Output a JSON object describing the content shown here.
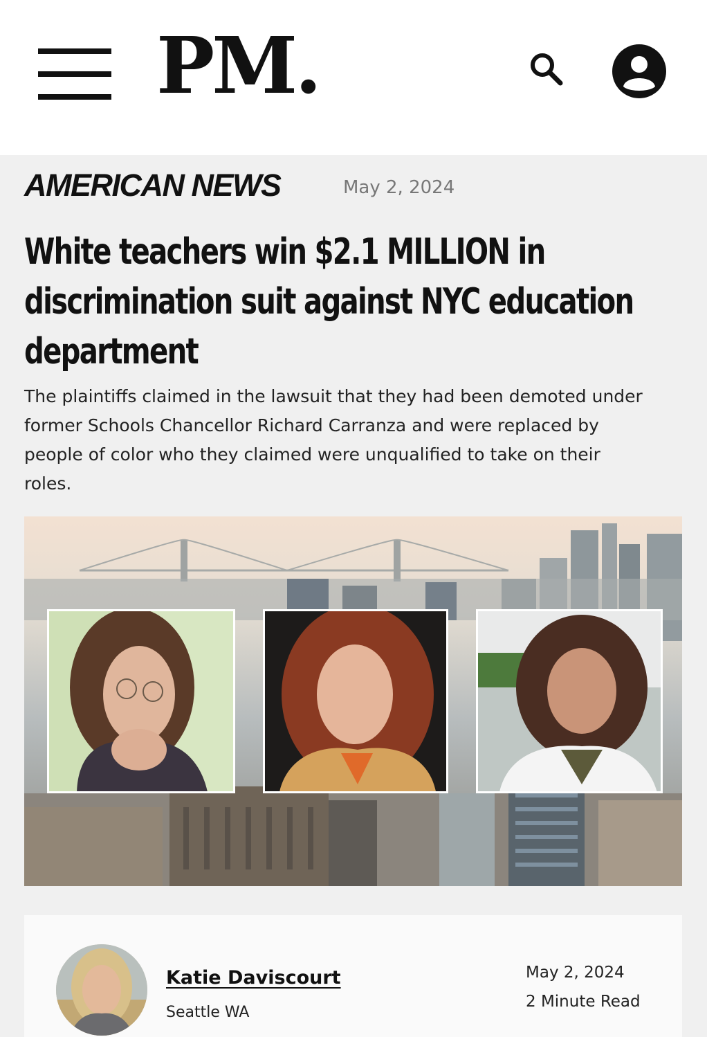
{
  "header": {
    "logo": "PM.",
    "menu_icon": "hamburger-menu-icon",
    "search_icon": "search-icon",
    "account_icon": "user-account-icon"
  },
  "article": {
    "category": "AMERICAN NEWS",
    "date": "May 2, 2024",
    "headline": "White teachers win $2.1 MILLION in discrimination suit against NYC education department",
    "dek": "The plaintiffs claimed in the lawsuit that they had been demoted under former Schools Chancellor Richard Carranza and were replaced by people of color who they claimed were unqualified to take on their roles."
  },
  "byline": {
    "author": "Katie Daviscourt",
    "location": "Seattle WA",
    "date": "May 2, 2024",
    "read_time": "2 Minute Read"
  },
  "colors": {
    "text": "#111111",
    "muted": "#777777",
    "article_bg": "#f0f0f0",
    "card_bg": "#fafafa"
  }
}
